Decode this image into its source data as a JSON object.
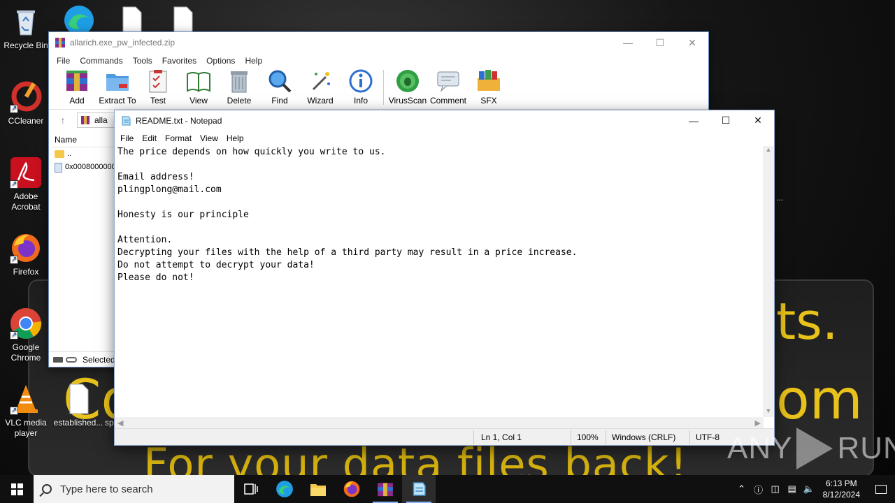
{
  "desktop": {
    "icons": [
      {
        "label": "Recycle Bin"
      },
      {
        "label": "CCleaner"
      },
      {
        "label": "Adobe Acrobat"
      },
      {
        "label": "Firefox"
      },
      {
        "label": "Google Chrome"
      },
      {
        "label": "VLC media player"
      },
      {
        "label": "established..."
      },
      {
        "label": "sp"
      }
    ],
    "wallpaper": {
      "line1": "ts.",
      "line2": "Co",
      "line3": "om",
      "line4": "For your data files back!",
      "ellipsis": "..."
    }
  },
  "winrar": {
    "title": "allarich.exe_pw_infected.zip",
    "menu": [
      "File",
      "Commands",
      "Tools",
      "Favorites",
      "Options",
      "Help"
    ],
    "toolbar": [
      "Add",
      "Extract To",
      "Test",
      "View",
      "Delete",
      "Find",
      "Wizard",
      "Info",
      "VirusScan",
      "Comment",
      "SFX"
    ],
    "path_text": "alla",
    "column_name": "Name",
    "rows": [
      "..",
      "0x0008000000"
    ],
    "status": "Selected"
  },
  "notepad": {
    "title": "README.txt - Notepad",
    "menu": [
      "File",
      "Edit",
      "Format",
      "View",
      "Help"
    ],
    "content": "The price depends on how quickly you write to us.\n\nEmail address!\nplingplong@mail.com\n\nHonesty is our principle\n\nAttention.\nDecrypting your files with the help of a third party may result in a price increase.\nDo not attempt to decrypt your data!\nPlease do not!",
    "status": {
      "position": "Ln 1, Col 1",
      "zoom": "100%",
      "line_ending": "Windows (CRLF)",
      "encoding": "UTF-8"
    }
  },
  "watermark": {
    "left": "ANY",
    "right": "RUN"
  },
  "taskbar": {
    "search_placeholder": "Type here to search",
    "time": "6:13 PM",
    "date": "8/12/2024"
  },
  "colors": {
    "wallpaper_text": "#e8c21a",
    "taskbar": "#101010",
    "accent": "#8ab4f8"
  }
}
